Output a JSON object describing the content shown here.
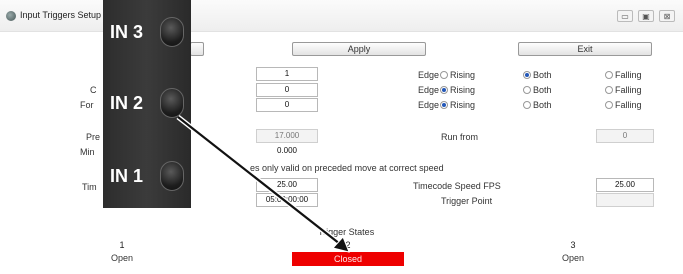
{
  "window": {
    "title": "Input Triggers Setup",
    "controls": {
      "minimize": "▭",
      "maximize": "▣",
      "close": "⊠"
    }
  },
  "toolbar": {
    "apply_label": "Apply",
    "exit_label": "Exit"
  },
  "inputs": [
    {
      "value": "1",
      "edge_label": "Edge",
      "options": [
        "Rising",
        "Both",
        "Falling"
      ],
      "selected": "Both"
    },
    {
      "value": "0",
      "edge_label": "Edge",
      "options": [
        "Rising",
        "Both",
        "Falling"
      ],
      "selected": "Rising"
    },
    {
      "value": "0",
      "edge_label": "Edge",
      "options": [
        "Rising",
        "Both",
        "Falling"
      ],
      "selected": "Rising"
    }
  ],
  "labels": {
    "row2_fragment": "C",
    "row3_fragment": "For",
    "pre_fragment": "Pre",
    "min_fragment": "Min",
    "time_fragment": "Tim",
    "run_from": "Run from",
    "note": "es only valid on preceded move at correct speed",
    "timecode_fps": "Timecode Speed FPS",
    "trigger_point": "Trigger Point",
    "trigger_states_title": "Trigger States"
  },
  "values": {
    "pre": "17.000",
    "min": "0.000",
    "run_from": "0",
    "time": "25.00",
    "timecode_fps": "25.00",
    "timecode": "05:00:00:00"
  },
  "states": [
    {
      "number": "1",
      "status": "Open"
    },
    {
      "number": "2",
      "status": "Closed"
    },
    {
      "number": "3",
      "status": "Open"
    }
  ],
  "overlay": {
    "panel_labels": [
      "IN 3",
      "IN 2",
      "IN 1"
    ],
    "panel_color": "#333333",
    "arrow_color": "#111111",
    "closed_color": "#ee0000"
  }
}
